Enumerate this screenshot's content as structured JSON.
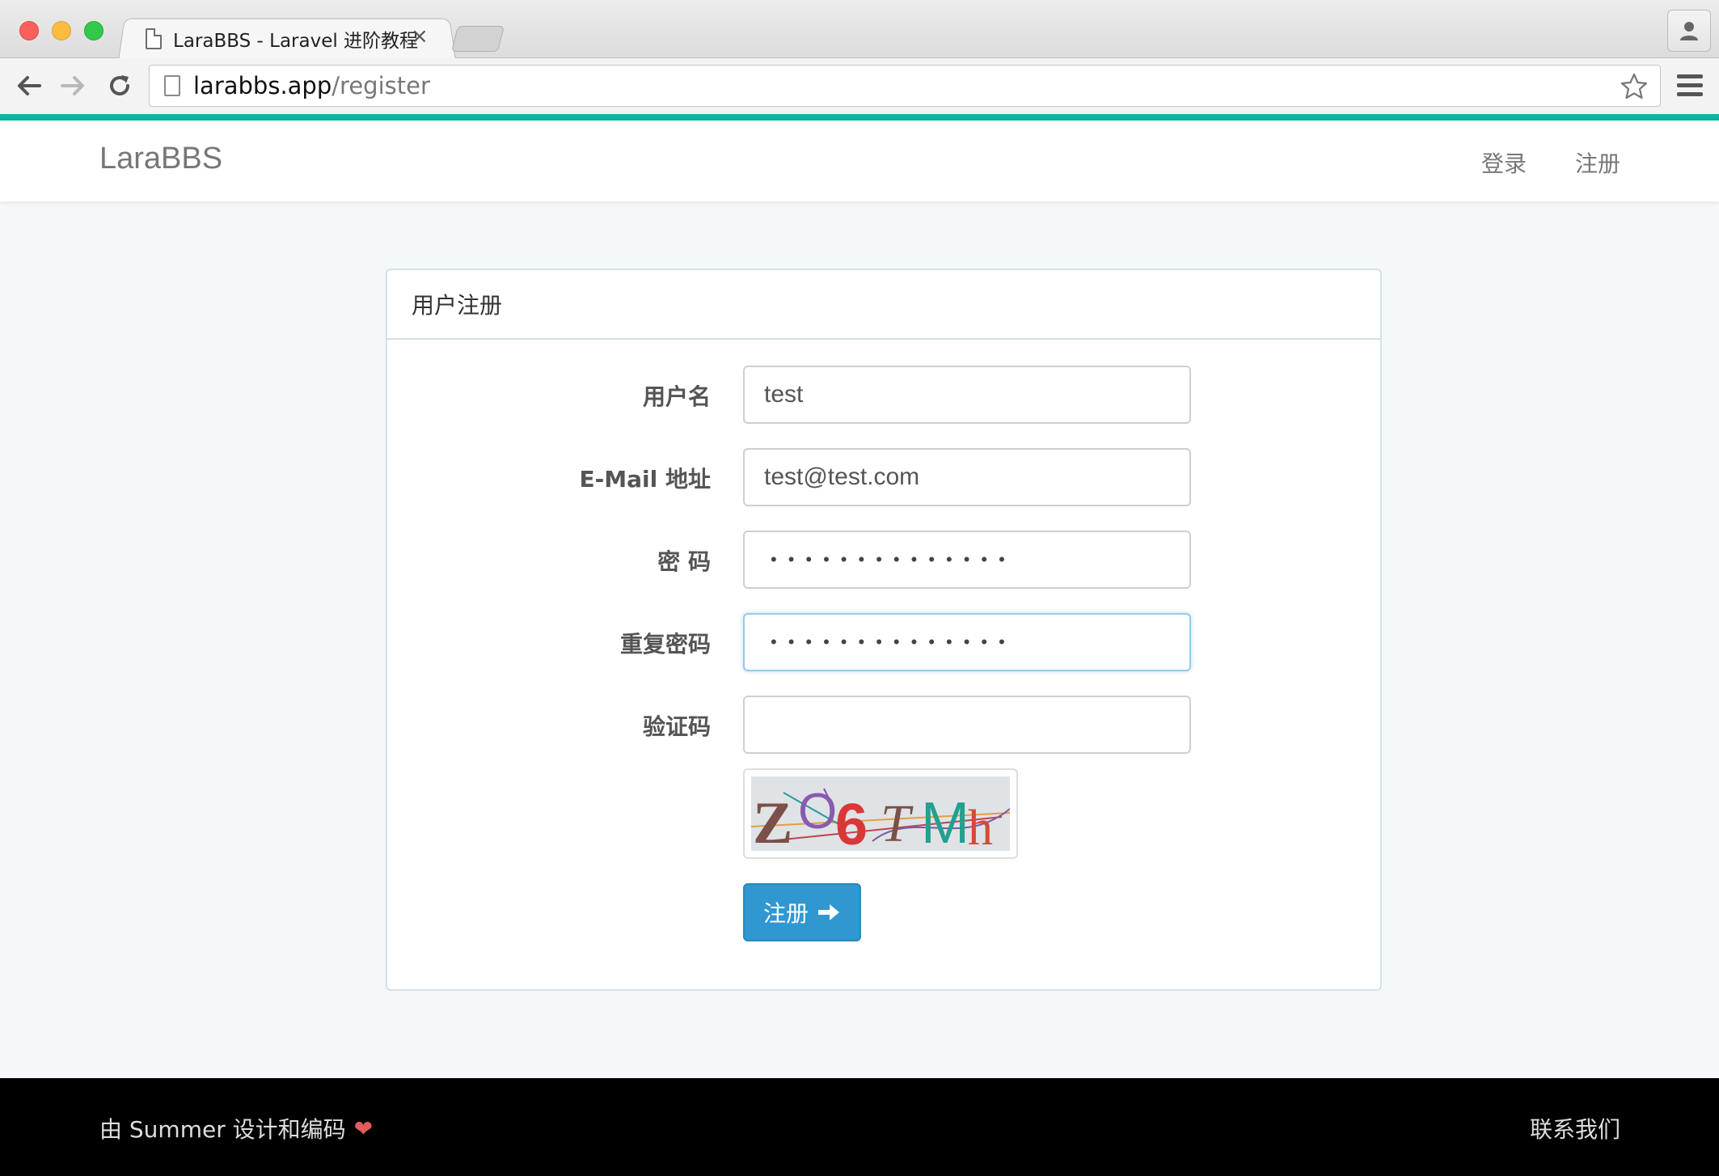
{
  "browser": {
    "tab_title": "LaraBBS - Laravel 进阶教程",
    "tab_close": "×",
    "url_host": "larabbs.app",
    "url_path": "/register"
  },
  "navbar": {
    "brand": "LaraBBS",
    "login": "登录",
    "register": "注册"
  },
  "panel": {
    "heading": "用户注册",
    "fields": {
      "username_label": "用户名",
      "username_value": "test",
      "email_label": "E-Mail 地址",
      "email_value": "test@test.com",
      "password_label": "密 码",
      "password_value": "••••••••••••••",
      "password_confirm_label": "重复密码",
      "password_confirm_value": "••••••••••••••",
      "captcha_label": "验证码",
      "captcha_value": ""
    },
    "captcha_text": "ZO6TMh",
    "submit_label": "注册"
  },
  "footer": {
    "credit": "由 Summer 设计和编码",
    "contact": "联系我们"
  },
  "colors": {
    "accent": "#3097d1",
    "teal_bar": "#13b1a4",
    "heart": "#e35b5b"
  }
}
